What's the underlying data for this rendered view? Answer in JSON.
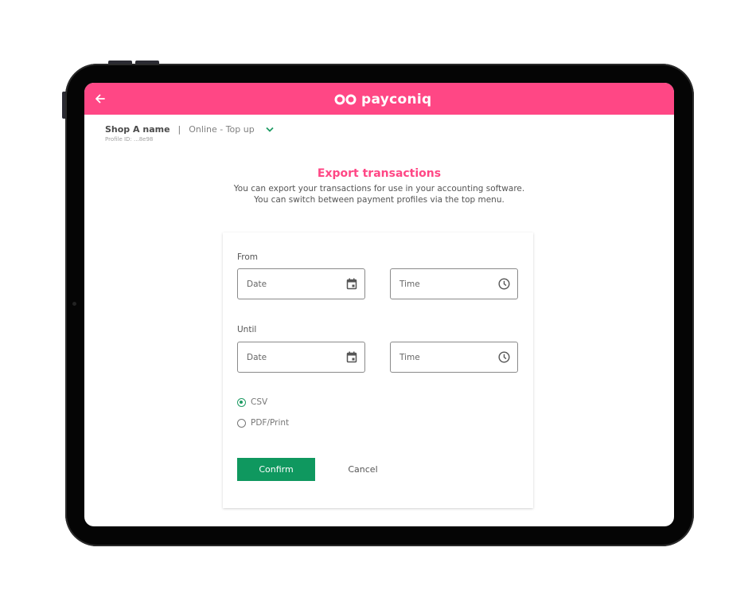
{
  "app": {
    "brand": "payconiq",
    "accent_color": "#ff4785",
    "primary_button_color": "#0f985f"
  },
  "header": {
    "back_icon": "arrow-left-icon",
    "logo_icon": "payconiq-infinity-icon"
  },
  "profile": {
    "shop_name": "Shop A name",
    "separator": "|",
    "selected_profile": "Online - Top up",
    "profile_id": "Profile ID: ...8e98",
    "dropdown_icon": "chevron-down-icon"
  },
  "page": {
    "title": "Export transactions",
    "description_line1": "You can export your transactions for use in your accounting software.",
    "description_line2": "You can switch between payment profiles via the top menu."
  },
  "form": {
    "from": {
      "label": "From",
      "date_placeholder": "Date",
      "time_placeholder": "Time"
    },
    "until": {
      "label": "Until",
      "date_placeholder": "Date",
      "time_placeholder": "Time"
    },
    "formats": [
      {
        "label": "CSV",
        "selected": true
      },
      {
        "label": "PDF/Print",
        "selected": false
      }
    ],
    "confirm_label": "Confirm",
    "cancel_label": "Cancel"
  }
}
